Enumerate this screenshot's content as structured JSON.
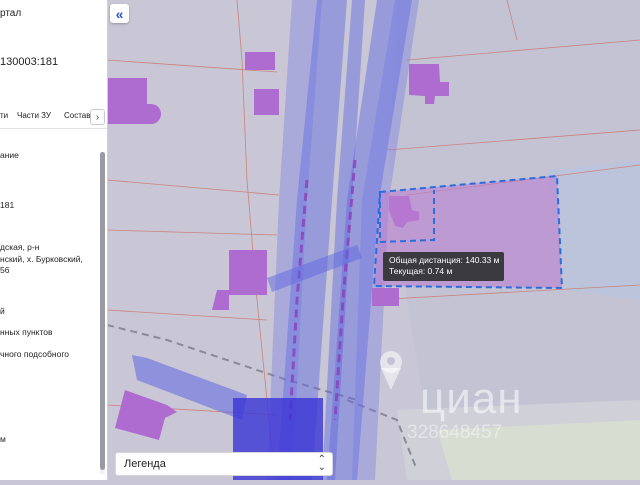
{
  "panel": {
    "portal_label": "ртал",
    "cadastral_number": "130003:181",
    "tabs": [
      "ти",
      "Части ЗУ",
      "Состав"
    ],
    "tab_next": "›",
    "fields": [
      "ание",
      "181",
      "дская, р-н",
      "нский, х. Бурковский,",
      "56",
      "й",
      "нных пунктов",
      "чного подсобного",
      "м"
    ]
  },
  "map": {
    "collapse_icon": "«",
    "tooltip": {
      "total": "Общая дистанция: 140.33 м",
      "current": "Текущая: 0.74 м"
    },
    "legend": {
      "label": "Легенда",
      "toggle_icon": "chevron-up-down-icon"
    },
    "watermark": {
      "text": "циан",
      "id": "328648457"
    },
    "colors": {
      "measure_line": "#2a6de0",
      "parcel_fill": "#b97fcf",
      "road_blue": "#5d66e0"
    }
  }
}
